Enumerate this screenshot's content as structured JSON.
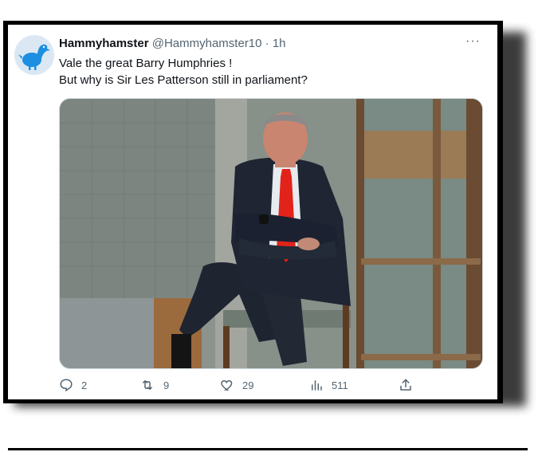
{
  "tweet": {
    "display_name": "Hammyhamster",
    "handle": "@Hammyhamster10",
    "separator": "·",
    "time": "1h",
    "more": "···",
    "line1": "Vale the great Barry Humphries !",
    "line2": "But why is Sir Les Patterson still in parliament?"
  },
  "actions": {
    "replies": "2",
    "retweets": "9",
    "likes": "29",
    "views": "511"
  },
  "colors": {
    "text": "#0f1419",
    "muted": "#536471",
    "avatar_bird": "#1d8fe0",
    "tie": "#e2231a"
  },
  "icons": [
    "dodo-avatar",
    "more-icon",
    "reply-icon",
    "retweet-icon",
    "like-icon",
    "views-icon",
    "share-icon"
  ]
}
